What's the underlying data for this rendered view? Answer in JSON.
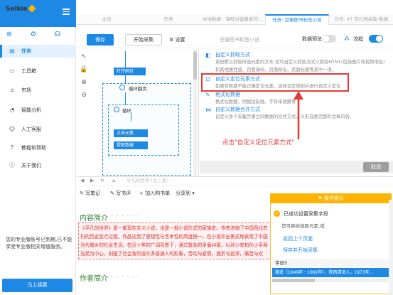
{
  "sidebar": {
    "brand": "Selkie",
    "items": [
      {
        "label": "任务",
        "icon": "document-icon",
        "active": true
      },
      {
        "label": "工具箱",
        "icon": "toolbox-icon",
        "active": false
      },
      {
        "label": "市场",
        "icon": "market-icon",
        "active": false
      },
      {
        "label": "智能分析",
        "icon": "chart-icon",
        "active": false
      },
      {
        "label": "人工客服",
        "icon": "support-icon",
        "active": false
      },
      {
        "label": "教程和帮助",
        "icon": "help-icon",
        "active": false
      },
      {
        "label": "关于我们",
        "icon": "info-icon",
        "active": false
      }
    ],
    "note": "您的专业版账号已到期,已不能享受专业版相关增值服务。",
    "upgrade": "马上续费"
  },
  "tabs": [
    {
      "label": "主页",
      "active": false
    },
    {
      "label": "任务",
      "active": false
    },
    {
      "label": "本地数据：海咬对盗墓者的...",
      "active": false
    },
    {
      "label": "任务: 豆瓣图书标签小说",
      "active": true
    },
    {
      "label": "任务: 47 百灶网采集-数据",
      "active": false
    }
  ],
  "toolbar": {
    "save": "保存",
    "start": "开始采集",
    "settings": "设置",
    "task_name": "豆瓣图书标签小说",
    "preview": "数据预览",
    "flow": "流程"
  },
  "flow": {
    "nodes": {
      "open_page": "打开网页",
      "loop_page": "循环翻页",
      "loop": "循环",
      "click": "点击元素",
      "extract": "提取数据"
    }
  },
  "options": [
    {
      "title": "自定义抓取方式",
      "desc": "系统默认抓取所选元素的文本,也可自定义抓取方式以抓取HTML(包括图片和视频地址)"
    },
    {
      "title": "",
      "desc": "和其他属性值、页面源码、页面网址、页面标题等其中一项。"
    },
    {
      "title": "自定义定位元素方式",
      "desc": "如果有数据不能正确定位元素，选择设定规则并进行自定义定位"
    },
    {
      "title": "格式化数据",
      "desc": "格式化数据，例如加前缀、字符串替换等"
    },
    {
      "title": "自定义数据合并方式",
      "desc": "自定义多个采集步骤之间数据的合并方式，以形成更完整的文章内容。"
    }
  ],
  "annotation": "点击\"自定义定位元素方式\"",
  "cancel": "取消",
  "browser": {
    "address": "平凡的世界 (全三册)",
    "actions": [
      "写笔记",
      "写书评",
      "加入购书单",
      "分享到"
    ],
    "section1": "内容简介",
    "para": "《平凡的世界》是一部现实主义小说，也是一部小说形式的家族史。作者浓缩了中国西北农村的历史变迁过程，作品达到了思想性与艺术性的高度统一，在小说中全景式地表现了中国当代城乡的社会生活。在近十年的广阔背景下，通过复杂的矛盾纠葛，以孙少安和孙少平两兄弟为中心，刻画了社会各阶层众多普通人的形象，劳动与爱情，挫折与追求，痛苦与欢乐，日常生活与巨大社会冲突纷繁地交织在一起，深刻地展示了普通人在大时代历史进程中所走过的艰难曲折的道路。",
    "section2": "作者简介",
    "dashes": "- - - - - -"
  },
  "tips": {
    "header": "操作提示",
    "title": "已成功设置采集字段",
    "sub": "您可继续选取元素,或:",
    "link1": "返回上个页面",
    "link2": "保存并开始采集",
    "column": "字段5",
    "value": "路遥（1949年－1992年），陕西清涧人，1973年..."
  }
}
